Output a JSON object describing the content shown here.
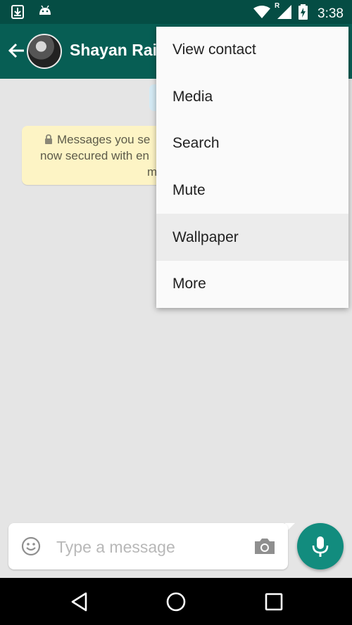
{
  "status_bar": {
    "time": "3:38",
    "icons": [
      "download-icon",
      "android-icon",
      "wifi-icon",
      "signal-icon",
      "battery-charging-icon"
    ],
    "roaming_label": "R"
  },
  "header": {
    "contact_name": "Shayan Rai",
    "icons": [
      "back-arrow-icon",
      "avatar"
    ]
  },
  "security_notice": {
    "line1": "Messages you se",
    "line2": "now secured with en",
    "line3": "m",
    "icon": "lock-icon"
  },
  "overflow_menu": {
    "items": [
      {
        "label": "View contact"
      },
      {
        "label": "Media"
      },
      {
        "label": "Search"
      },
      {
        "label": "Mute"
      },
      {
        "label": "Wallpaper",
        "highlighted": true
      },
      {
        "label": "More"
      }
    ]
  },
  "composer": {
    "placeholder": "Type a message",
    "icons": [
      "emoji-icon",
      "camera-icon",
      "mic-icon"
    ]
  },
  "nav_bar": {
    "icons": [
      "back-nav-icon",
      "home-nav-icon",
      "recents-nav-icon"
    ]
  },
  "colors": {
    "status_bar": "#054d44",
    "app_bar": "#075e54",
    "accent": "#128c7e",
    "chat_bg": "#e5e5e5",
    "notice_bg": "#fdf4c5",
    "menu_highlight": "#ececec"
  }
}
